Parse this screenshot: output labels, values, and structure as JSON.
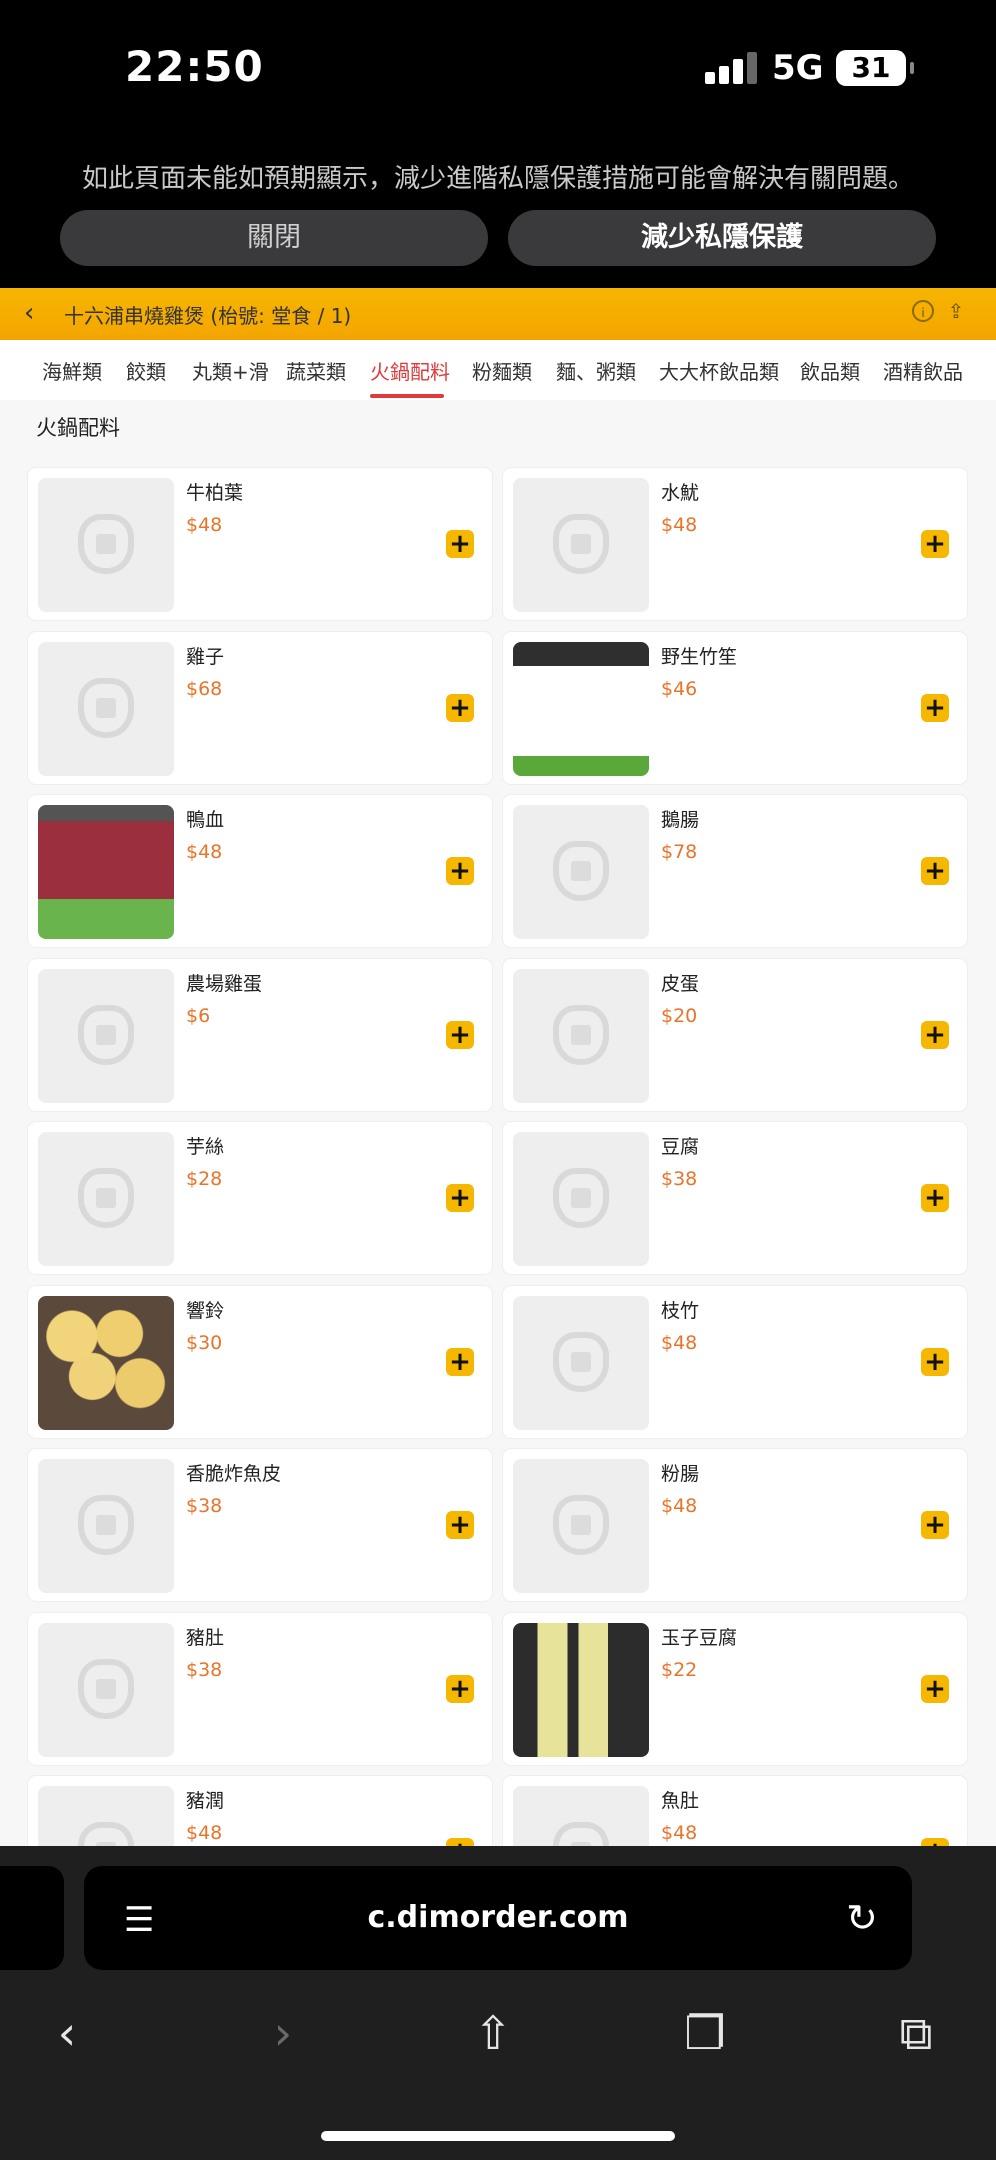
{
  "status": {
    "time": "22:50",
    "network": "5G",
    "battery": "31"
  },
  "privacy": {
    "message": "如此頁面未能如預期顯示，減少進階私隱保護措施可能會解決有關問題。",
    "close_label": "關閉",
    "reduce_label": "減少私隱保護"
  },
  "header": {
    "back": "‹",
    "title": "十六浦串燒雞煲 (枱號: 堂食 / 1)"
  },
  "tabs": [
    "海鮮類",
    "餃類",
    "丸類+滑",
    "蔬菜類",
    "火鍋配料",
    "粉麵類",
    "麵、粥類",
    "大大杯飲品類",
    "飲品類",
    "酒精飲品"
  ],
  "active_tab": "火鍋配料",
  "section_title": "火鍋配料",
  "items": [
    {
      "name": "牛柏葉",
      "price": "$48"
    },
    {
      "name": "水魷",
      "price": "$48"
    },
    {
      "name": "雞子",
      "price": "$68"
    },
    {
      "name": "野生竹笙",
      "price": "$46"
    },
    {
      "name": "鴨血",
      "price": "$48"
    },
    {
      "name": "鵝腸",
      "price": "$78"
    },
    {
      "name": "農場雞蛋",
      "price": "$6"
    },
    {
      "name": "皮蛋",
      "price": "$20"
    },
    {
      "name": "芋絲",
      "price": "$28"
    },
    {
      "name": "豆腐",
      "price": "$38"
    },
    {
      "name": "響鈴",
      "price": "$30"
    },
    {
      "name": "枝竹",
      "price": "$48"
    },
    {
      "name": "香脆炸魚皮",
      "price": "$38"
    },
    {
      "name": "粉腸",
      "price": "$48"
    },
    {
      "name": "豬肚",
      "price": "$38"
    },
    {
      "name": "玉子豆腐",
      "price": "$22"
    },
    {
      "name": "豬潤",
      "price": "$48"
    },
    {
      "name": "魚肚",
      "price": "$48"
    }
  ],
  "add_symbol": "+",
  "browser": {
    "url": "c.dimorder.com"
  },
  "colors": {
    "accent": "#f5b700",
    "active_tab": "#e03a3a",
    "price": "#e8742a"
  }
}
